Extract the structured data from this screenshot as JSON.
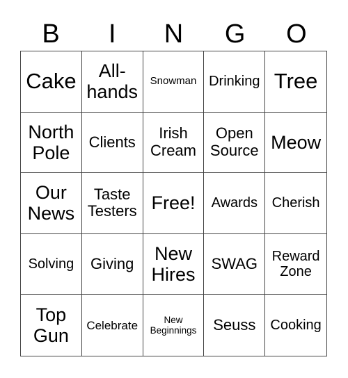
{
  "header": {
    "letters": [
      "B",
      "I",
      "N",
      "G",
      "O"
    ]
  },
  "cells": [
    [
      "Cake",
      "All-\nhands",
      "Snowman",
      "Drinking",
      "Tree"
    ],
    [
      "North\nPole",
      "Clients",
      "Irish\nCream",
      "Open\nSource",
      "Meow"
    ],
    [
      "Our\nNews",
      "Taste\nTesters",
      "Free!",
      "Awards",
      "Cherish"
    ],
    [
      "Solving",
      "Giving",
      "New\nHires",
      "SWAG",
      "Reward\nZone"
    ],
    [
      "Top\nGun",
      "Celebrate",
      "New\nBeginnings",
      "Seuss",
      "Cooking"
    ]
  ]
}
